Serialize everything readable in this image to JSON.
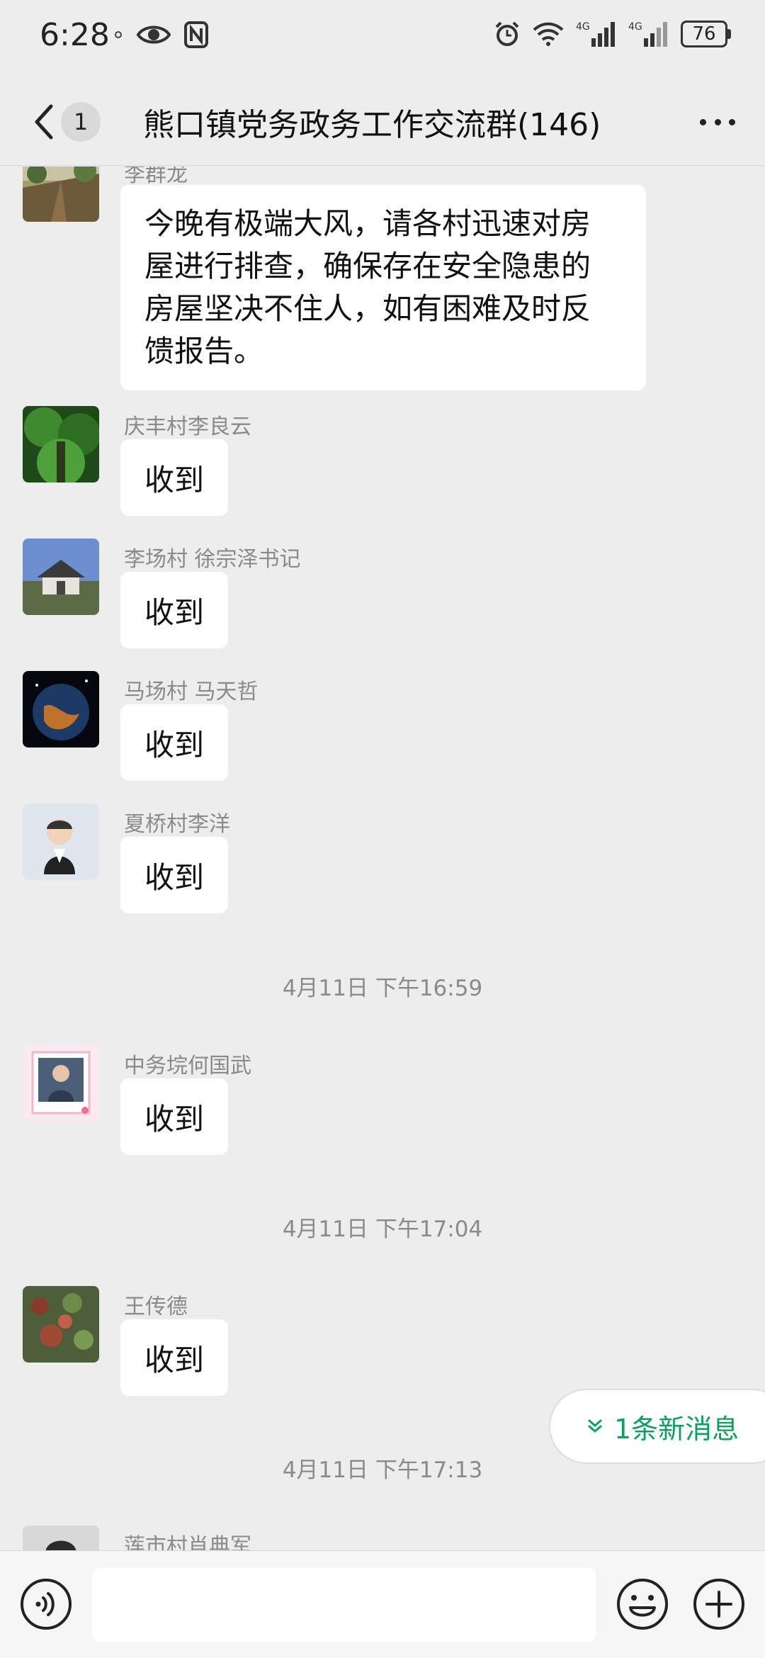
{
  "status_bar": {
    "time": "6:28",
    "battery": "76",
    "signal_label_1": "4G",
    "signal_label_2": "4G"
  },
  "header": {
    "unread_count": "1",
    "title": "熊口镇党务政务工作交流群(146)"
  },
  "messages": [
    {
      "sender": "李群龙",
      "text_lines": [
        "今晚有极端大风，请各村迅速对房",
        "屋进行排查，确保存在安全隐患的",
        "房屋坚决不住人，如有困难及时反",
        "馈报告。"
      ]
    },
    {
      "sender": "庆丰村李良云",
      "text": "收到"
    },
    {
      "sender": "李场村 徐宗泽书记",
      "text": "收到"
    },
    {
      "sender": "马场村 马天哲",
      "text": "收到"
    },
    {
      "sender": "夏桥村李洋",
      "text": "收到"
    },
    {
      "sender": "中务垸何国武",
      "text": "收到"
    },
    {
      "sender": "王传德",
      "text": "收到"
    },
    {
      "sender": "莲市村肖典军"
    }
  ],
  "timestamps": [
    "4月11日 下午16:59",
    "4月11日 下午17:04",
    "4月11日 下午17:13"
  ],
  "new_message_pill": {
    "label": "1条新消息"
  },
  "input_bar": {
    "placeholder": ""
  },
  "icons": [
    "back-icon",
    "more-icon",
    "eye-icon",
    "nfc-icon",
    "alarm-icon",
    "wifi-icon",
    "signal-icon",
    "battery-icon",
    "double-chevron-down-icon",
    "voice-icon",
    "emoji-icon",
    "plus-icon"
  ],
  "colors": {
    "background": "#ededed",
    "bubble": "#ffffff",
    "accent_green": "#07a35a",
    "meta_text": "#8a8a8a"
  }
}
